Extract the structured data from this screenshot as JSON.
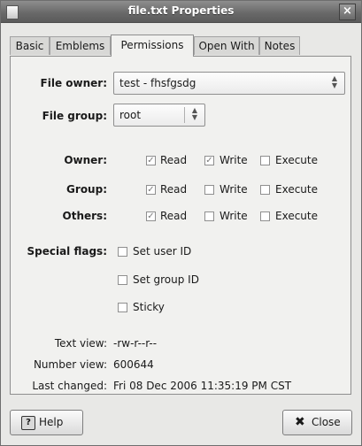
{
  "window": {
    "title": "file.txt Properties",
    "close_glyph": "×"
  },
  "tabs": [
    {
      "label": "Basic"
    },
    {
      "label": "Emblems"
    },
    {
      "label": "Permissions"
    },
    {
      "label": "Open With"
    },
    {
      "label": "Notes"
    }
  ],
  "active_tab": "Permissions",
  "owner": {
    "label": "File owner:",
    "value": "test - fhsfgsdg"
  },
  "group": {
    "label": "File group:",
    "value": "root"
  },
  "permissions": {
    "rows": [
      {
        "label": "Owner:",
        "read": true,
        "write": true,
        "execute": false
      },
      {
        "label": "Group:",
        "read": true,
        "write": false,
        "execute": false
      },
      {
        "label": "Others:",
        "read": true,
        "write": false,
        "execute": false
      }
    ],
    "read_label": "Read",
    "write_label": "Write",
    "execute_label": "Execute"
  },
  "special_flags": {
    "label": "Special flags:",
    "items": [
      {
        "label": "Set user ID",
        "checked": false
      },
      {
        "label": "Set group ID",
        "checked": false
      },
      {
        "label": "Sticky",
        "checked": false
      }
    ]
  },
  "text_view": {
    "label": "Text view:",
    "value": "-rw-r--r--"
  },
  "number_view": {
    "label": "Number view:",
    "value": "600644"
  },
  "last_changed": {
    "label": "Last changed:",
    "value": "Fri 08 Dec 2006 11:35:19 PM CST"
  },
  "buttons": {
    "help": "Help",
    "close": "Close"
  }
}
